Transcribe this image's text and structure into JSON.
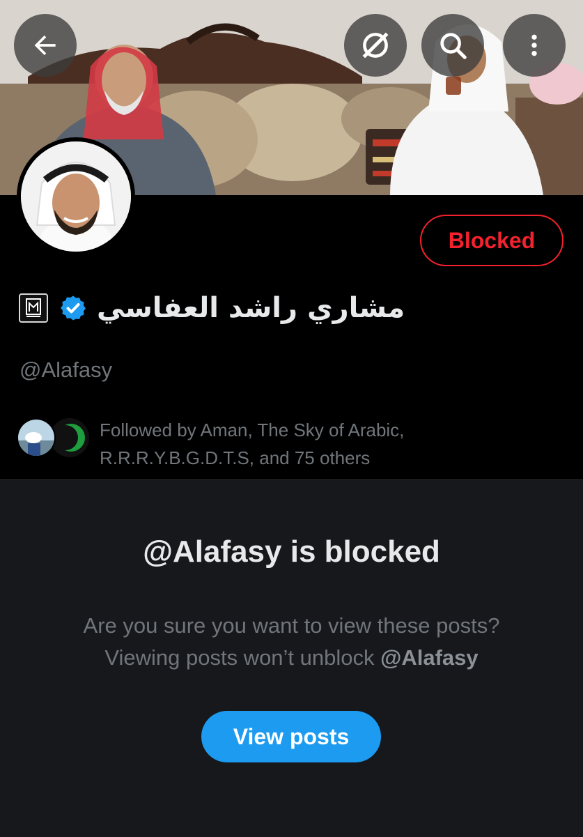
{
  "header": {
    "back_icon": "arrow-left-icon",
    "grok_icon": "grok-icon",
    "search_icon": "search-icon",
    "more_icon": "more-vertical-icon"
  },
  "profile": {
    "display_name": "مشاري راشد العفاسي",
    "affiliate_badge_icon": "affiliate-badge-icon",
    "verified_icon": "verified-badge-icon",
    "handle": "@Alafasy",
    "blocked_label": "Blocked",
    "followed_by": "Followed by Aman, The Sky of Arabic, R.R.R.Y.B.G.D.T.S, and 75 others"
  },
  "blocked_notice": {
    "title": "@Alafasy is blocked",
    "line1": "Are you sure you want to view these posts?",
    "line2_prefix": "Viewing posts won’t unblock ",
    "line2_handle": "@Alafasy",
    "view_posts_label": "View posts"
  },
  "colors": {
    "blocked_red": "#f4212e",
    "accent_blue": "#1d9bf0",
    "muted_text": "#71767b"
  }
}
